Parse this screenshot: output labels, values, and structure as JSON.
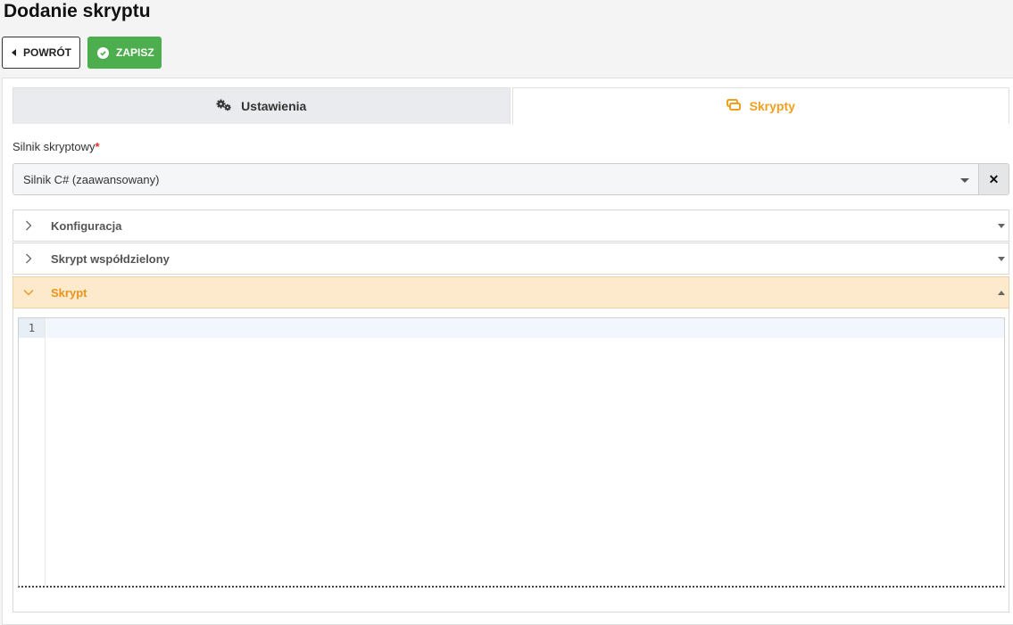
{
  "page": {
    "title": "Dodanie skryptu"
  },
  "toolbar": {
    "back_label": "POWRÓT",
    "save_label": "ZAPISZ"
  },
  "tabs": [
    {
      "label": "Ustawienia",
      "icon": "gears-icon",
      "active": false
    },
    {
      "label": "Skrypty",
      "icon": "scripts-icon",
      "active": true
    }
  ],
  "form": {
    "engine_label": "Silnik skryptowy",
    "required_mark": "*",
    "engine_value": "Silnik C# (zaawansowany)",
    "clear_symbol": "✕"
  },
  "accordion": [
    {
      "label": "Konfiguracja",
      "open": false
    },
    {
      "label": "Skrypt współdzielony",
      "open": false
    },
    {
      "label": "Skrypt",
      "open": true
    }
  ],
  "editor": {
    "line_numbers": [
      "1"
    ]
  },
  "colors": {
    "accent": "#f0a020",
    "save": "#4cae4c",
    "open_section_bg": "#fde9cc"
  }
}
